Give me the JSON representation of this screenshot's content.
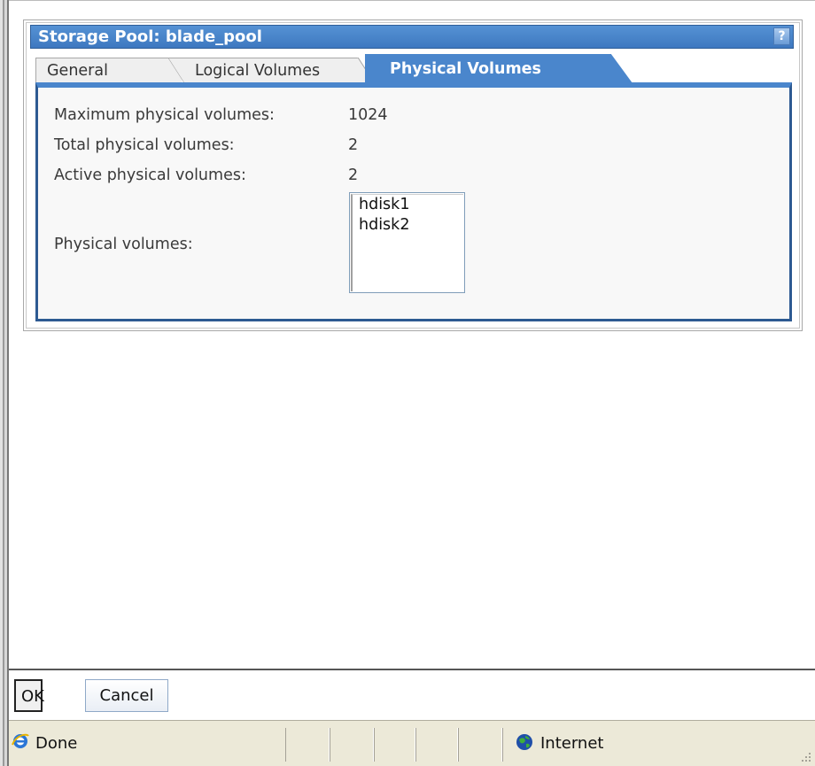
{
  "dialog": {
    "title": "Storage Pool: blade_pool",
    "help_label": "?",
    "tabs": [
      {
        "label": "General",
        "selected": false
      },
      {
        "label": "Logical Volumes",
        "selected": false
      },
      {
        "label": "Physical Volumes",
        "selected": true
      }
    ],
    "fields": {
      "max_label": "Maximum physical volumes:",
      "max_value": "1024",
      "total_label": "Total physical volumes:",
      "total_value": "2",
      "active_label": "Active physical volumes:",
      "active_value": "2",
      "list_label": "Physical volumes:"
    },
    "physical_volumes": [
      "hdisk1",
      "hdisk2"
    ]
  },
  "buttons": {
    "ok_label": "OK",
    "cancel_label": "Cancel"
  },
  "statusbar": {
    "status_text": "Done",
    "zone_text": "Internet"
  },
  "colors": {
    "accent": "#4a86cc",
    "titlebar": "#3e78c0",
    "panel_border": "#2d5a92",
    "statusbar_bg": "#ece9d8"
  }
}
